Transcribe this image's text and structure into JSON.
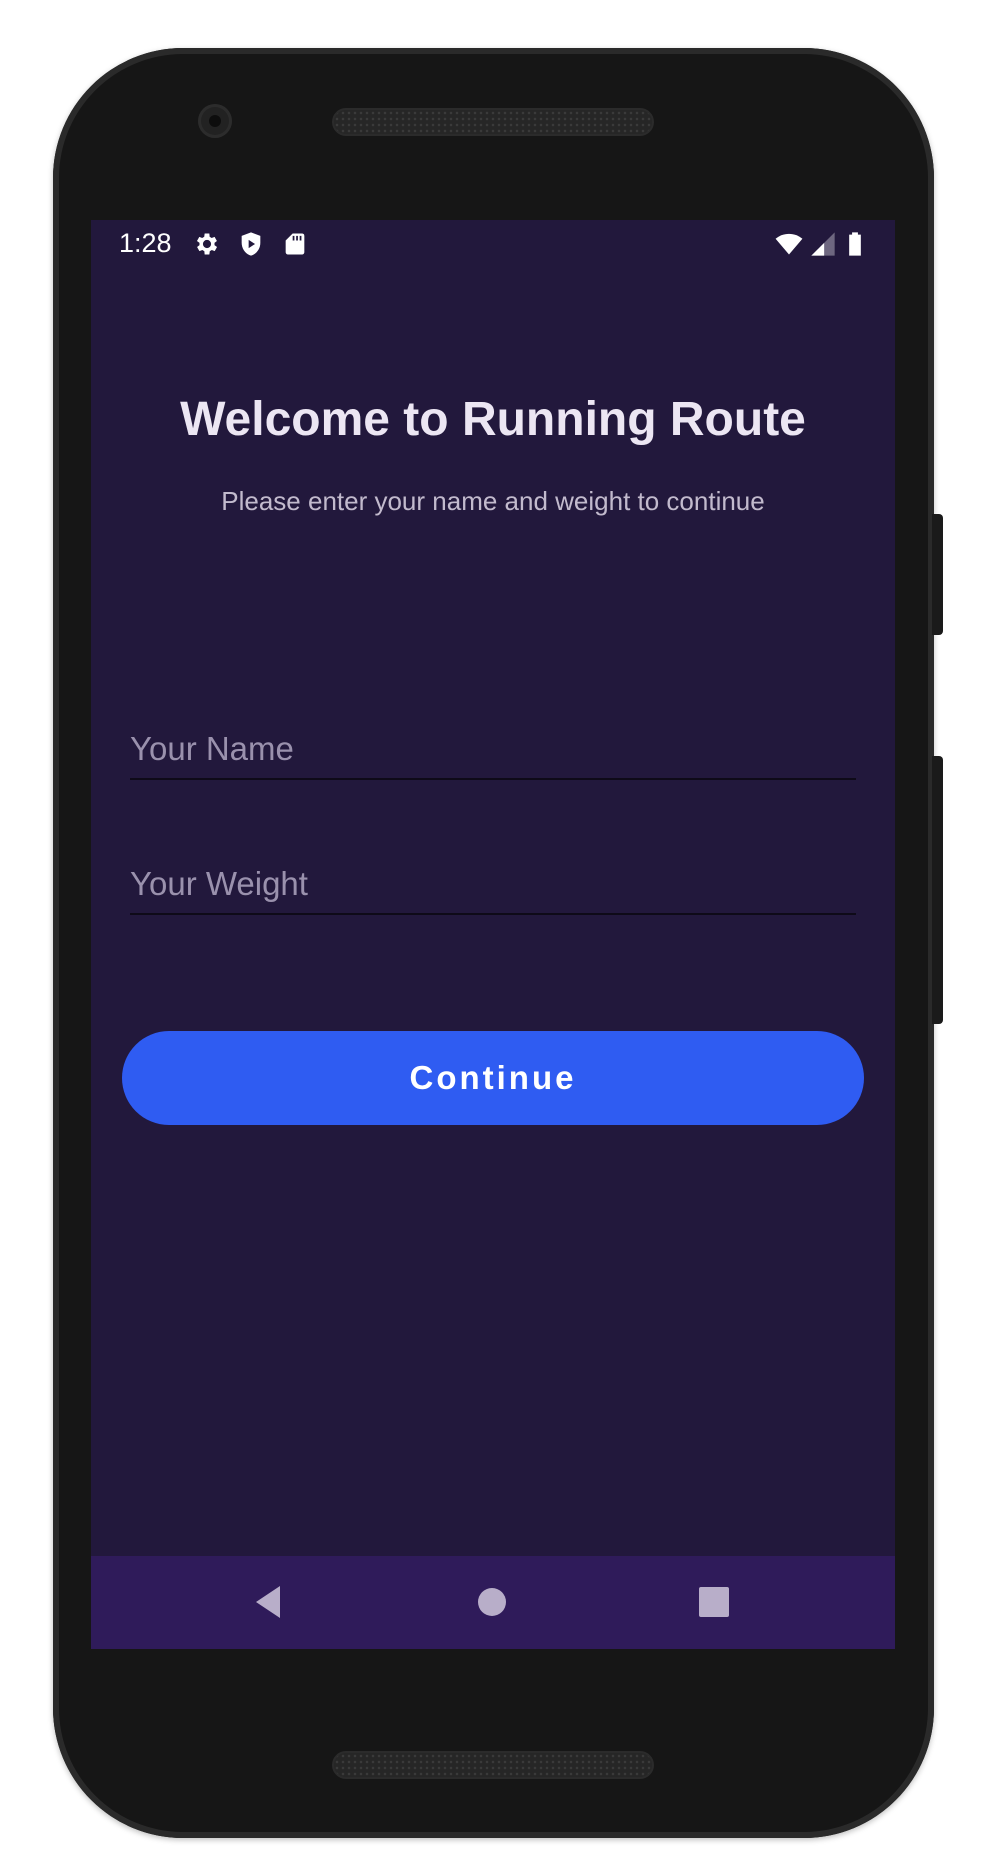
{
  "status_bar": {
    "time": "1:28",
    "left_icons": [
      "gear-icon",
      "shield-play-icon",
      "sd-card-icon"
    ],
    "right_icons": [
      "wifi-icon",
      "cell-signal-icon",
      "battery-icon"
    ]
  },
  "welcome": {
    "title": "Welcome to Running Route",
    "subtitle": "Please enter your name and weight to continue"
  },
  "form": {
    "name_placeholder": "Your Name",
    "name_value": "",
    "weight_placeholder": "Your Weight",
    "weight_value": "",
    "continue_label": "Continue"
  },
  "nav_bar": {
    "buttons": [
      "back-icon",
      "home-icon",
      "recents-icon"
    ]
  },
  "colors": {
    "screen_background": "#22183c",
    "nav_bar_background": "#2f1b5a",
    "primary_button": "#2f5cf2",
    "title_text": "#ece6f3",
    "subtitle_text": "#c2bacd",
    "placeholder_text": "#9a91ad"
  }
}
